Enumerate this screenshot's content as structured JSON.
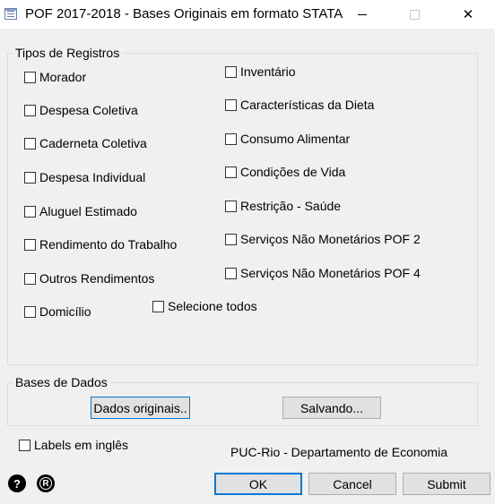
{
  "window": {
    "title": "POF 2017-2018 - Bases Originais em formato STATA"
  },
  "tipos": {
    "legend": "Tipos de Registros",
    "left": [
      "Morador",
      "Despesa Coletiva",
      "Caderneta Coletiva",
      "Despesa Individual",
      "Aluguel Estimado",
      "Rendimento do Trabalho",
      "Outros Rendimentos",
      "Domicílio"
    ],
    "right": [
      "Inventário",
      "Características da Dieta",
      "Consumo Alimentar",
      "Condições de Vida",
      "Restrição - Saúde",
      "Serviços Não Monetários POF 2",
      "Serviços Não Monetários POF 4"
    ],
    "select_all": "Selecione todos"
  },
  "bases": {
    "legend": "Bases de Dados",
    "dados_button": "Dados originais..",
    "salvando_button": "Salvando..."
  },
  "labels_checkbox": "Labels em inglês",
  "footer_credit": "PUC-Rio - Departamento de Economia",
  "bottom": {
    "help_icon": "?",
    "r_icon": "R",
    "ok": "OK",
    "cancel": "Cancel",
    "submit": "Submit"
  }
}
